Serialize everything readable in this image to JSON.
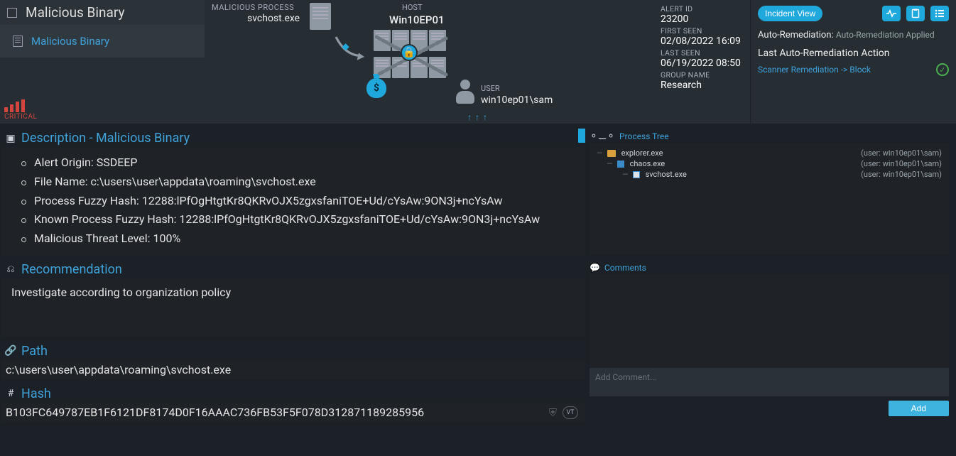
{
  "header": {
    "title": "Malicious Binary",
    "subtitle": "Malicious Binary",
    "severity": "CRITICAL",
    "malicious_process_label": "MALICIOUS PROCESS",
    "malicious_process": "svchost.exe",
    "host_label": "HOST",
    "host": "Win10EP01",
    "user_label": "USER",
    "user": "win10ep01\\sam"
  },
  "meta": {
    "alert_id_label": "ALERT ID",
    "alert_id": "23200",
    "first_seen_label": "FIRST SEEN",
    "first_seen": "02/08/2022 16:09",
    "last_seen_label": "LAST SEEN",
    "last_seen": "06/19/2022 08:50",
    "group_name_label": "GROUP NAME",
    "group_name": "Research"
  },
  "right": {
    "incident_view": "Incident View",
    "auto_rem_label": "Auto-Remediation:",
    "auto_rem_value": "Auto-Remediation Applied",
    "last_action_label": "Last Auto-Remediation Action",
    "action_link": "Scanner Remediation -> Block"
  },
  "description": {
    "title": "Description - Malicious Binary",
    "items": [
      "Alert Origin: SSDEEP",
      "File Name: c:\\users\\user\\appdata\\roaming\\svchost.exe",
      "Process Fuzzy Hash: 12288:lPfOgHtgtKr8QKRvOJX5zgxsfaniTOE+Ud/cYsAw:9ON3j+ncYsAw",
      "Known Process Fuzzy Hash: 12288:lPfOgHtgtKr8QKRvOJX5zgxsfaniTOE+Ud/cYsAw:9ON3j+ncYsAw",
      "Malicious Threat Level: 100%"
    ]
  },
  "recommendation": {
    "title": "Recommendation",
    "text": "Investigate according to organization policy"
  },
  "path": {
    "title": "Path",
    "value": "c:\\users\\user\\appdata\\roaming\\svchost.exe"
  },
  "hash": {
    "title": "Hash",
    "value": "B103FC649787EB1F6121DF8174D0F16AAAC736FB53F5F078D312871189285956"
  },
  "process_tree": {
    "title": "Process Tree",
    "rows": [
      {
        "level": 0,
        "icon": "folder",
        "name": "explorer.exe",
        "user": "(user: win10ep01\\sam)"
      },
      {
        "level": 1,
        "icon": "cube",
        "name": "chaos.exe",
        "user": "(user: win10ep01\\sam)"
      },
      {
        "level": 2,
        "icon": "exe",
        "name": "svchost.exe",
        "user": "(user: win10ep01\\sam)"
      }
    ]
  },
  "comments": {
    "title": "Comments",
    "placeholder": "Add Comment...",
    "add_button": "Add"
  }
}
